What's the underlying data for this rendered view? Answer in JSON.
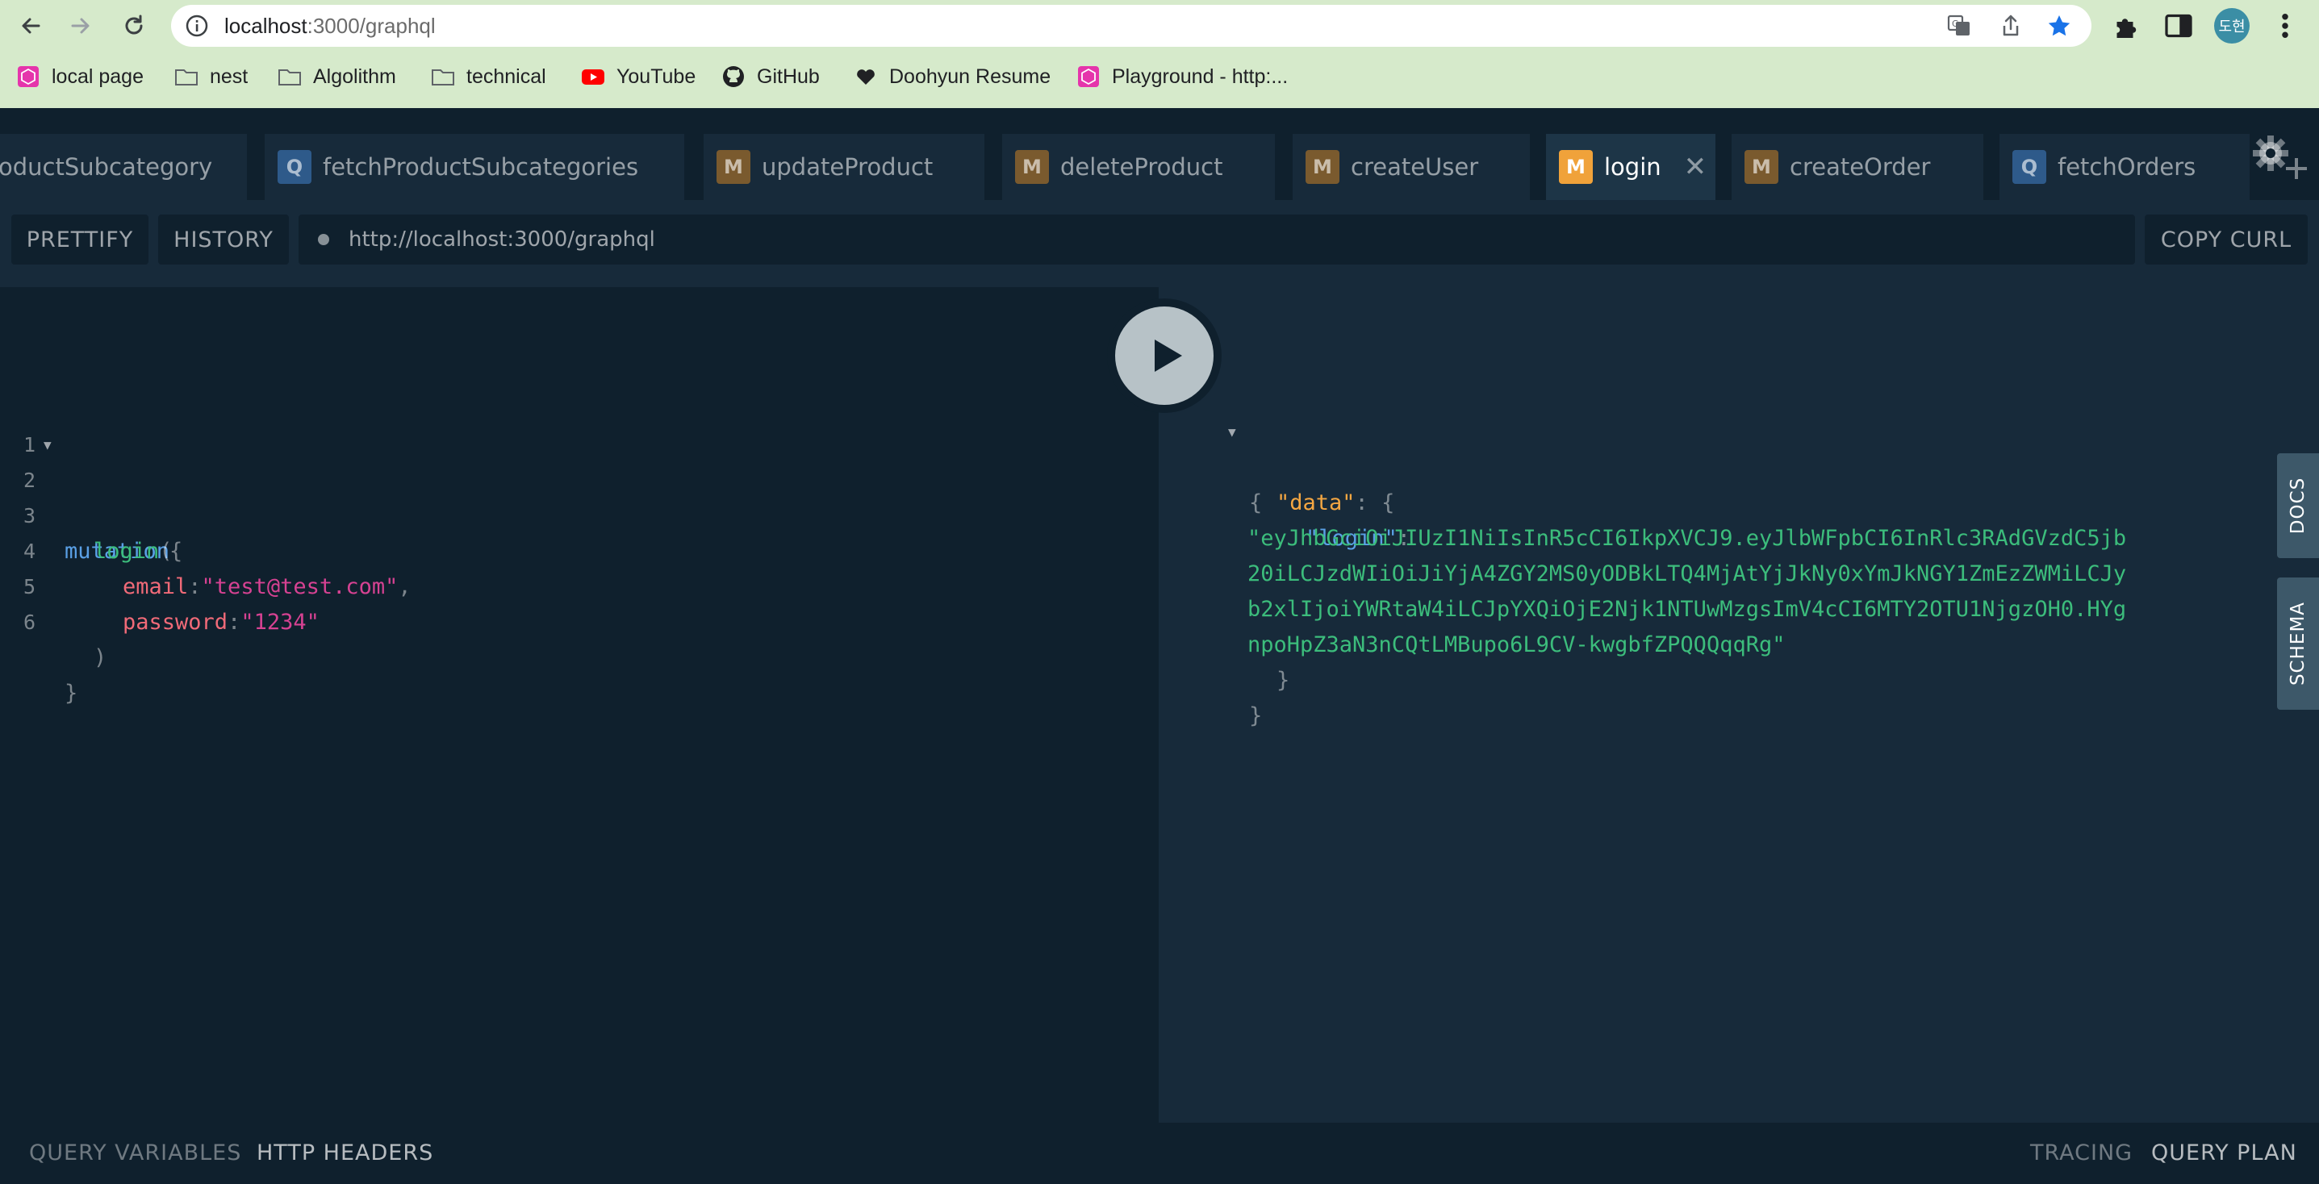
{
  "browser": {
    "url_host": "localhost",
    "url_path": ":3000/graphql",
    "nav": {
      "back_icon": "back-arrow-icon",
      "forward_icon": "forward-arrow-icon",
      "reload_icon": "reload-icon"
    },
    "profile_initials": "도현",
    "bookmarks": [
      {
        "label": "local page",
        "icon": "graphql-pink-icon"
      },
      {
        "label": "nest",
        "icon": "folder-icon"
      },
      {
        "label": "Algolithm",
        "icon": "folder-icon"
      },
      {
        "label": "technical",
        "icon": "folder-icon"
      },
      {
        "label": "YouTube",
        "icon": "youtube-icon"
      },
      {
        "label": "GitHub",
        "icon": "github-icon"
      },
      {
        "label": "Doohyun Resume",
        "icon": "heart-icon"
      },
      {
        "label": "Playground - http:...",
        "icon": "graphql-pink-icon"
      }
    ]
  },
  "tabs": [
    {
      "badge": "",
      "label": "oductSubcategory",
      "active": false
    },
    {
      "badge": "Q",
      "label": "fetchProductSubcategories",
      "active": false
    },
    {
      "badge": "M",
      "label": "updateProduct",
      "active": false
    },
    {
      "badge": "M",
      "label": "deleteProduct",
      "active": false
    },
    {
      "badge": "M",
      "label": "createUser",
      "active": false
    },
    {
      "badge": "M",
      "label": "login",
      "active": true,
      "close": "✕"
    },
    {
      "badge": "M",
      "label": "createOrder",
      "active": false
    },
    {
      "badge": "Q",
      "label": "fetchOrders",
      "active": false
    }
  ],
  "editor_bar": {
    "prettify": "PRETTIFY",
    "history": "HISTORY",
    "endpoint": "http://localhost:3000/graphql",
    "copy_curl": "COPY CURL"
  },
  "query": {
    "line_numbers": [
      "1",
      "2",
      "3",
      "4",
      "5",
      "6"
    ],
    "mutation_kw": "mutation",
    "open_brace": "{",
    "login_fn": "login",
    "open_paren": "(",
    "email_arg": "email",
    "email_val": "\"test@test.com\"",
    "password_arg": "password",
    "password_val": "\"1234\"",
    "close_paren": ")",
    "close_brace": "}",
    "colon": ":",
    "comma": ","
  },
  "result": {
    "open_brace": "{",
    "data_key": "\"data\"",
    "login_key": "\"login\"",
    "token_lines": [
      "\"eyJhbGciOiJIUzI1NiIsInR5cCI6IkpXVCJ9.eyJlbWFpbCI6InRlc3RAdGVzdC5jb",
      "20iLCJzdWIiOiJiYjA4ZGY2MS0yODBkLTQ4MjAtYjJkNy0xYmJkNGY1ZmEzZWMiLCJy",
      "b2xlIjoiYWRtaW4iLCJpYXQiOjE2Njk1NTUwMzgsImV4cCI6MTY2OTU1NjgzOH0.HYg",
      "npoHpZ3aN3nCQtLMBupo6L9CV-kwgbfZPQQQqqRg\""
    ],
    "close_inner": "}",
    "close_outer": "}"
  },
  "side_tabs": {
    "docs": "DOCS",
    "schema": "SCHEMA"
  },
  "bottom": {
    "query_variables": "QUERY VARIABLES",
    "http_headers": "HTTP HEADERS",
    "tracing": "TRACING",
    "query_plan": "QUERY PLAN"
  }
}
